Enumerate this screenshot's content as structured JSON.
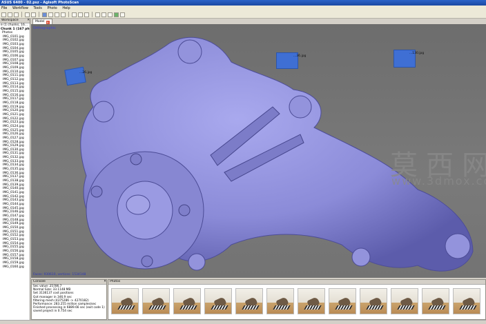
{
  "window": {
    "title": "ASUS 6400 - 02.psz - Agisoft PhotoScan"
  },
  "menu": [
    "File",
    "Workflow",
    "Tools",
    "Photo",
    "Help"
  ],
  "workspace": {
    "header": "Workspace",
    "chunk": "Chunk 1 (167 pho...",
    "chunks_line": "e (1 chunks, 16...",
    "photos_label": "Photos",
    "photos": [
      "IMG_0101.jpg",
      "IMG_0102.jpg",
      "IMG_0103.jpg",
      "IMG_0104.jpg",
      "IMG_0105.jpg",
      "IMG_0106.jpg",
      "IMG_0107.jpg",
      "IMG_0108.jpg",
      "IMG_0109.jpg",
      "IMG_0110.jpg",
      "IMG_0111.jpg",
      "IMG_0112.jpg",
      "IMG_0113.jpg",
      "IMG_0114.jpg",
      "IMG_0115.jpg",
      "IMG_0116.jpg",
      "IMG_0117.jpg",
      "IMG_0118.jpg",
      "IMG_0119.jpg",
      "IMG_0120.jpg",
      "IMG_0121.jpg",
      "IMG_0122.jpg",
      "IMG_0123.jpg",
      "IMG_0124.jpg",
      "IMG_0125.jpg",
      "IMG_0126.jpg",
      "IMG_0127.jpg",
      "IMG_0128.jpg",
      "IMG_0129.jpg",
      "IMG_0130.jpg",
      "IMG_0131.jpg",
      "IMG_0132.jpg",
      "IMG_0133.jpg",
      "IMG_0134.jpg",
      "IMG_0135.jpg",
      "IMG_0136.jpg",
      "IMG_0137.jpg",
      "IMG_0138.jpg",
      "IMG_0139.jpg",
      "IMG_0140.jpg",
      "IMG_0141.jpg",
      "IMG_0142.jpg",
      "IMG_0143.jpg",
      "IMG_0144.jpg",
      "IMG_0145.jpg",
      "IMG_0146.jpg",
      "IMG_0147.jpg",
      "IMG_0148.jpg",
      "IMG_0149.jpg",
      "IMG_0150.jpg",
      "IMG_0151.jpg",
      "IMG_0152.jpg",
      "IMG_0153.jpg",
      "IMG_0154.jpg",
      "IMG_0155.jpg",
      "IMG_0156.jpg",
      "IMG_0157.jpg",
      "IMG_0158.jpg",
      "IMG_0159.jpg",
      "IMG_0160.jpg"
    ]
  },
  "model_view": {
    "tab_label": "Model",
    "perspective_label": "Orthographic",
    "stats": "Faces: 930610, vertices: 1534148",
    "camera_labels": [
      "...26.jpg",
      "...36.jpg",
      "...130.jpg"
    ],
    "model_color": "#8f8fdc"
  },
  "watermark": {
    "cn": "莫西网",
    "url": "www.3dmox.com"
  },
  "console": {
    "header": "Console",
    "lines": [
      "Sec value: 25786.7",
      "Normal Size: 33.1148 MB",
      "Set 3136137 cost positions",
      "Got manager in 346.9 sec",
      "filtering mesh (4375286 -> 4270182)",
      "Performance: 283.255 million samples/sec",
      "Finished processing in 6889.66 sec (exit code 1)",
      "saved project in 0.754 sec"
    ]
  },
  "photos_panel": {
    "header": "Photos",
    "thumb_count": 12
  }
}
